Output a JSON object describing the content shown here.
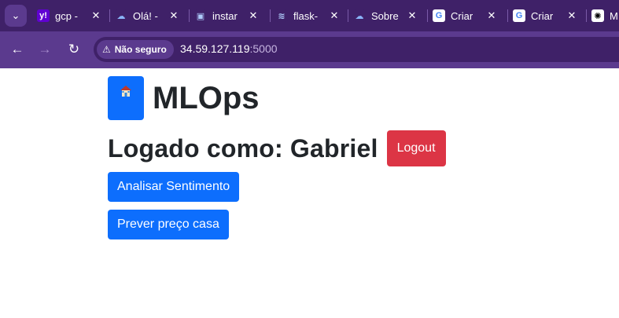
{
  "browser": {
    "tabs": [
      {
        "title": "gcp -",
        "icon": "yahoo-icon",
        "icon_glyph": "y!",
        "icon_bg": "#6001d2"
      },
      {
        "title": "Olá! -",
        "icon": "google-cloud-icon",
        "icon_glyph": "☁",
        "icon_bg": "#3f2168"
      },
      {
        "title": "instar",
        "icon": "compute-engine-icon",
        "icon_glyph": "▣",
        "icon_bg": "#3f2168"
      },
      {
        "title": "flask-",
        "icon": "layers-icon",
        "icon_glyph": "≋",
        "icon_bg": "#3f2168"
      },
      {
        "title": "Sobre",
        "icon": "google-cloud-icon",
        "icon_glyph": "☁",
        "icon_bg": "#3f2168"
      },
      {
        "title": "Criar",
        "icon": "google-icon",
        "icon_glyph": "G",
        "icon_bg": "#ffffff"
      },
      {
        "title": "Criar",
        "icon": "google-icon",
        "icon_glyph": "G",
        "icon_bg": "#ffffff"
      },
      {
        "title": "M",
        "icon": "openai-icon",
        "icon_glyph": "✺",
        "icon_bg": "#ffffff"
      }
    ],
    "security_label": "Não seguro",
    "url_host": "34.59.127.119",
    "url_port": ":5000"
  },
  "page": {
    "brand_title": "MLOps",
    "home_icon": "house-icon",
    "user_label": "Logado como: Gabriel",
    "logout_label": "Logout",
    "actions": [
      {
        "label": "Analisar Sentimento"
      },
      {
        "label": "Prever preço casa"
      }
    ]
  },
  "colors": {
    "primary": "#0d6efd",
    "danger": "#dc3545",
    "browser_frame": "#5b3a8e"
  }
}
